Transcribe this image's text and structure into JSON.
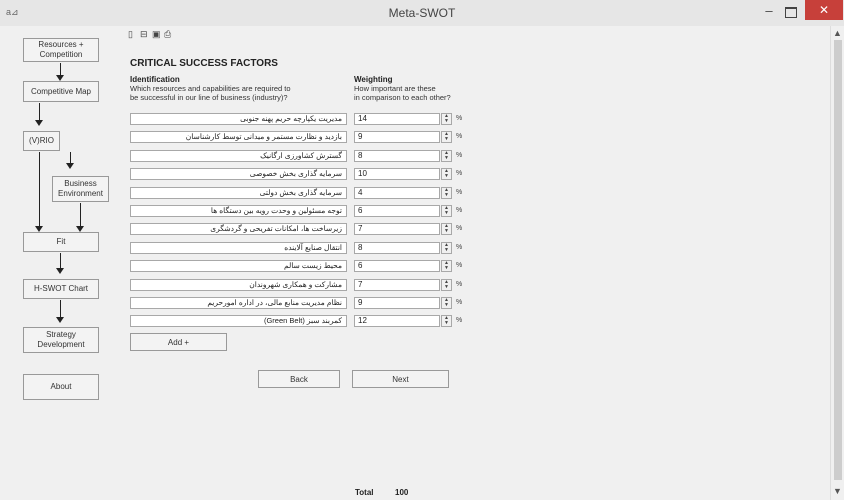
{
  "window": {
    "title": "Meta-SWOT",
    "minimize": "–",
    "close": "✕",
    "app_icon": "a⊿"
  },
  "sidebar": {
    "resources": "Resources + Competition",
    "competitive_map": "Competitive Map",
    "vrio": "(V)RIO",
    "business_env": "Business Environment",
    "fit": "Fit",
    "hswot": "H-SWOT Chart",
    "strategy": "Strategy Development",
    "about": "About"
  },
  "toolbar": {
    "icons": [
      "new-file-icon",
      "open-folder-icon",
      "save-icon",
      "print-icon"
    ]
  },
  "main": {
    "heading": "CRITICAL SUCCESS FACTORS",
    "identification_title": "Identification",
    "identification_sub1": "Which resources and capabilities are required to",
    "identification_sub2": "be successful in our line of business (industry)?",
    "weighting_title": "Weighting",
    "weighting_sub1": "How important are these",
    "weighting_sub2": "in comparison to each other?",
    "pct_symbol": "%",
    "rows": [
      {
        "factor": "مدیریت یکپارچه حریم پهنه جنوبی",
        "weight": "14"
      },
      {
        "factor": "بازدید و نظارت مستمر و میدانی توسط کارشناسان",
        "weight": "9"
      },
      {
        "factor": "گسترش کشاورزی ارگانیک",
        "weight": "8"
      },
      {
        "factor": "سرمایه گذاری بخش خصوصی",
        "weight": "10"
      },
      {
        "factor": "سرمایه گذاری بخش دولتی",
        "weight": "4"
      },
      {
        "factor": "توجه مسئولین و وحدت رویه بین دستگاه ها",
        "weight": "6"
      },
      {
        "factor": "زیرساخت ها، امکانات تفریحی و گردشگری",
        "weight": "7"
      },
      {
        "factor": "انتقال صنایع آلاینده",
        "weight": "8"
      },
      {
        "factor": "محیط زیست سالم",
        "weight": "6"
      },
      {
        "factor": "مشارکت و همکاری شهروندان",
        "weight": "7"
      },
      {
        "factor": "نظام مدیریت منابع مالی، در اداره امورحریم",
        "weight": "9"
      },
      {
        "factor": "کمربند سبز (Green Belt)",
        "weight": "12"
      }
    ],
    "add_button": "Add +",
    "back_button": "Back",
    "next_button": "Next",
    "total_label": "Total",
    "total_value": "100"
  }
}
